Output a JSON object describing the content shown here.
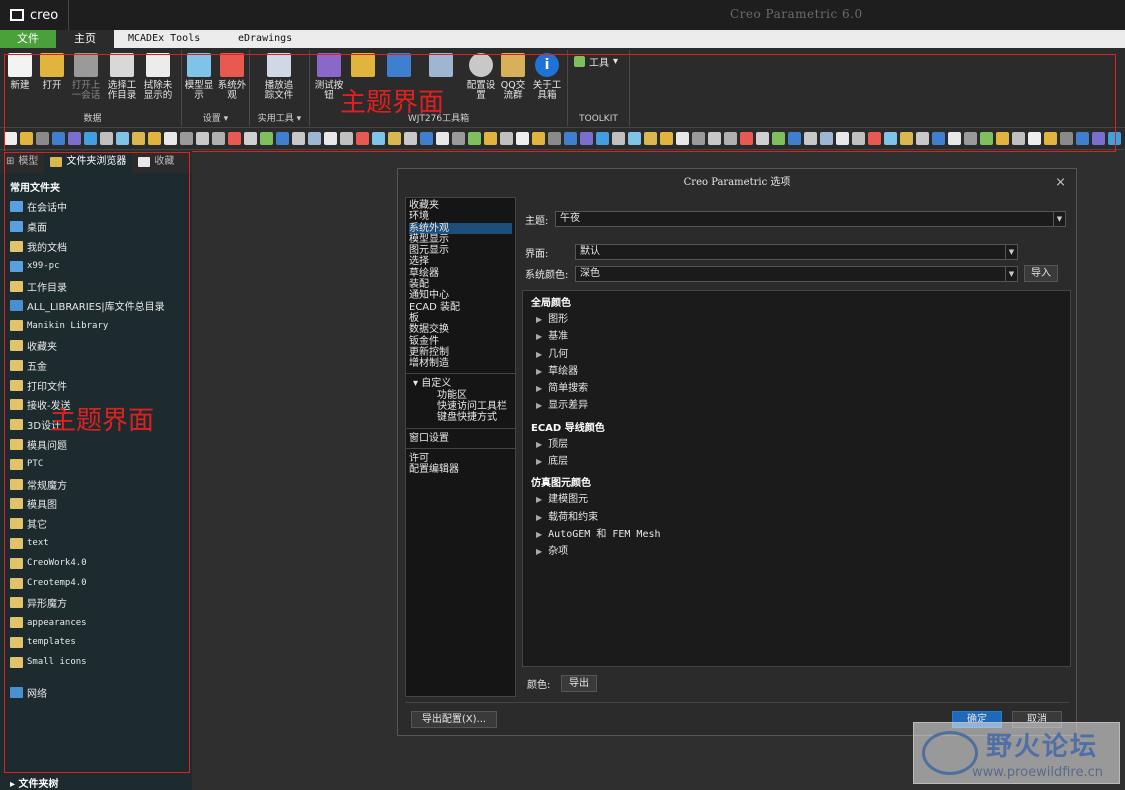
{
  "app": {
    "logo_text": "creo",
    "window_title": "Creo Parametric 6.0"
  },
  "tabs": [
    "文件",
    "主页",
    "MCADEx Tools",
    "eDrawings"
  ],
  "ribbon": {
    "data_group": {
      "label": "数据",
      "buttons": [
        {
          "label": "新建",
          "icon": "new-doc-icon"
        },
        {
          "label": "打开",
          "icon": "open-folder-icon"
        },
        {
          "label": "打开上一会话",
          "icon": "open-last-session-icon"
        },
        {
          "label": "选择工作目录",
          "icon": "select-workdir-icon"
        },
        {
          "label": "拭除未显示的",
          "icon": "erase-not-displayed-icon"
        }
      ]
    },
    "settings_group": {
      "label": "设置",
      "buttons": [
        {
          "label": "模型显示",
          "icon": "model-display-icon"
        },
        {
          "label": "系统外观",
          "icon": "system-appearance-icon"
        }
      ]
    },
    "utility_group": {
      "label": "实用工具",
      "buttons": [
        {
          "label": "播放追踪文件",
          "icon": "play-trail-icon"
        }
      ]
    },
    "wjt_group": {
      "label": "WJT276工具箱",
      "buttons": [
        {
          "label": "测试按钮",
          "icon": "test-button-icon"
        },
        {
          "label": "",
          "icon": "folder-icon"
        },
        {
          "label": "",
          "icon": "tool-icon"
        },
        {
          "label": "",
          "icon": "grid-icon"
        },
        {
          "label": "配置设置",
          "icon": "gear-icon"
        },
        {
          "label": "QQ交流群",
          "icon": "people-icon"
        },
        {
          "label": "关于工具箱",
          "icon": "info-icon"
        }
      ]
    },
    "toolkit_group": {
      "label": "TOOLKIT",
      "tools_label": "工具"
    },
    "annotation": "主题界面"
  },
  "left_panel": {
    "tabs": [
      "模型",
      "文件夹浏览器",
      "收藏"
    ],
    "heading": "常用文件夹",
    "items": [
      {
        "label": "在会话中",
        "icon": "session-icon"
      },
      {
        "label": "桌面",
        "icon": "desktop-icon"
      },
      {
        "label": "我的文档",
        "icon": "documents-icon"
      },
      {
        "label": "x99-pc",
        "icon": "computer-icon"
      },
      {
        "label": "工作目录",
        "icon": "folder-icon"
      },
      {
        "label": "ALL_LIBRARIES|库文件总目录",
        "icon": "chart-folder-icon"
      },
      {
        "label": "Manikin Library",
        "icon": "library-icon"
      },
      {
        "label": "收藏夹",
        "icon": "favorites-icon"
      },
      {
        "label": "五金",
        "icon": "folder-icon"
      },
      {
        "label": "打印文件",
        "icon": "folder-icon"
      },
      {
        "label": "接收-发送",
        "icon": "folder-icon"
      },
      {
        "label": "3D设计",
        "icon": "folder-icon"
      },
      {
        "label": "模具问题",
        "icon": "folder-icon"
      },
      {
        "label": "PTC",
        "icon": "folder-icon"
      },
      {
        "label": "常规魔方",
        "icon": "folder-icon"
      },
      {
        "label": "模具图",
        "icon": "folder-icon"
      },
      {
        "label": "其它",
        "icon": "folder-icon"
      },
      {
        "label": "text",
        "icon": "folder-icon"
      },
      {
        "label": "CreoWork4.0",
        "icon": "folder-icon"
      },
      {
        "label": "Creotemp4.0",
        "icon": "folder-icon"
      },
      {
        "label": "异形魔方",
        "icon": "folder-icon"
      },
      {
        "label": "appearances",
        "icon": "folder-icon"
      },
      {
        "label": "templates",
        "icon": "folder-icon"
      },
      {
        "label": "Small icons",
        "icon": "folder-icon"
      }
    ],
    "network": "网络",
    "footer": "文件夹树",
    "annotation": "主题界面"
  },
  "dialog": {
    "title": "Creo Parametric 选项",
    "close": "×",
    "nav": {
      "items": [
        "收藏夹",
        "环境",
        "系统外观",
        "模型显示",
        "图元显示",
        "选择",
        "草绘器",
        "装配",
        "通知中心",
        "ECAD 装配",
        "板",
        "数据交换",
        "钣金件",
        "更新控制",
        "增材制造"
      ],
      "selected_index": 2,
      "customize": "自定义",
      "customize_children": [
        "功能区",
        "快速访问工具栏",
        "键盘快捷方式"
      ],
      "window_settings": "窗口设置",
      "license": "许可",
      "config_editor": "配置编辑器"
    },
    "theme_label": "主题:",
    "theme_value": "午夜",
    "interface_label": "界面:",
    "interface_value": "默认",
    "system_color_label": "系统颜色:",
    "system_color_value": "深色",
    "import_button": "导入",
    "sections": [
      {
        "heading": "全局颜色",
        "items": [
          "图形",
          "基准",
          "几何",
          "草绘器",
          "简单搜索",
          "显示差异"
        ]
      },
      {
        "heading": "ECAD 导线颜色",
        "items": [
          "顶层",
          "底层"
        ]
      },
      {
        "heading": "仿真图元颜色",
        "items": [
          "建模图元",
          "载荷和约束",
          "AutoGEM 和 FEM Mesh",
          "杂项"
        ]
      }
    ],
    "color_label": "颜色:",
    "export_button": "导出",
    "export_config_button": "导出配置(X)...",
    "ok_button": "确定",
    "cancel_button": "取消"
  },
  "watermark": {
    "title": "野火论坛",
    "url": "www.proewildfire.cn"
  },
  "colors": {
    "accent_green": "#4aa039",
    "annotation_red": "#e02020",
    "selection_blue": "#1d4f7a",
    "ok_blue": "#1e69b9"
  }
}
